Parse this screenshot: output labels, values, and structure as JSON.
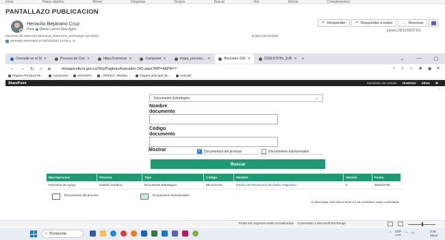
{
  "ribbon": {
    "items": [
      "Inicio",
      "Pasos rápidos",
      "Mover",
      "Etiquetas",
      "Grupos",
      "Buscar",
      "Voz",
      "Idioma",
      "Complementos"
    ]
  },
  "mail": {
    "subject": "PANTALLAZO PUBLICACION",
    "sender": "Heraclio Bejarano Cruz",
    "to_label": "Para",
    "to": "Diana Lucero Diaz Agon",
    "retention": "Directiva de retención  Directiva_Retencion_Exchange (10 años)",
    "expira": "Expira  28/12/2022",
    "forwarded": "Mensaje reenviado el 29/12/2022 10:05 a. m.",
    "reply_label": "Responder",
    "reply_all_label": "Responder a todos",
    "forward_label": "Reenviar",
    "date": "jueves 29/12/2022 9:5"
  },
  "browser": {
    "tabs": [
      {
        "label": "Consulte en el Si",
        "active": false
      },
      {
        "label": "Proceso de Con",
        "active": false
      },
      {
        "label": "https://commun",
        "active": false
      },
      {
        "label": "Camponet",
        "active": false
      },
      {
        "label": "mapa_proceso...",
        "active": false
      },
      {
        "label": "Buscador-SIG",
        "active": true
      },
      {
        "label": "22GESTION_JUR",
        "active": false
      }
    ],
    "url": "minagricultura.gov.co/SIG/Paginas/buscador-SIG.aspx?MP=4&PR=7",
    "bookmarks": [
      "Página Principal Mi...",
      "Camponet",
      "SOADOC",
      "::ORFEO, Módulo...",
      "Página principal de...",
      "Hotmail"
    ]
  },
  "sharepoint": {
    "title": "SharePoint",
    "right_items": [
      "Suministro de noticias",
      "OneDrive",
      "Sitios"
    ]
  },
  "form": {
    "doc_type_selected": "Documento Estratégico",
    "nombre_label": "Nombre documento",
    "codigo_label": "Código documento",
    "mostrar_label": "Mostrar",
    "check_proceso_label": "Documentos del proceso",
    "check_transversales_label": "Documentos transversales",
    "check_proceso_checked": true,
    "check_transversales_checked": false,
    "buscar_label": "Buscar"
  },
  "results": {
    "headers": [
      "Macroproceso",
      "Proceso",
      "Tipo",
      "Código",
      "Nombre",
      "Versión",
      "Fecha"
    ],
    "rows": [
      [
        "Procesos de Apoyo",
        "Gestión Jurídica",
        "Documento Estratégico",
        "DE-GJU-01",
        "Política de Prevención del Daño Antijurídico",
        "2",
        "2022/07/25"
      ]
    ]
  },
  "legend": {
    "proceso": "Documentos del proceso",
    "transversales": "Documentos transversales",
    "download_note": "Al descargar este documento no se considera copia controlada."
  },
  "status": {
    "folders": "Todas las carpetas están actualizadas.",
    "connection": "Conectado a Microsoft Exchange"
  },
  "taskbar": {
    "search_placeholder": "Búsqueda",
    "lang": "ESP",
    "lang2": "LAA",
    "time": "3:46",
    "date": "29/12"
  }
}
